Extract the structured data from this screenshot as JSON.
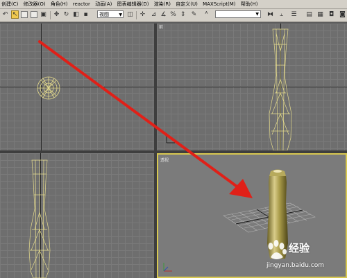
{
  "menu": {
    "items": [
      "创建(C)",
      "修改器(O)",
      "角色(H)",
      "reactor",
      "动画(A)",
      "图表编辑器(D)",
      "渲染(R)",
      "自定义(U)",
      "MAXScript(M)",
      "帮助(H)"
    ]
  },
  "toolbar": {
    "reference_coord": "视图",
    "named_selection": "",
    "icons": [
      "undo-icon",
      "redo-icon",
      "link-icon",
      "unlink-icon",
      "bind-space-warp-icon",
      "select-filter-icon",
      "select-object-icon",
      "select-by-name-icon",
      "rectangular-region-icon",
      "window-crossing-icon",
      "select-move-icon",
      "select-rotate-icon",
      "select-scale-icon",
      "snap-icon",
      "angle-snap-icon",
      "percent-snap-icon",
      "spinner-snap-icon",
      "mirror-icon",
      "align-icon",
      "layer-manager-icon",
      "curve-editor-icon",
      "material-editor-icon",
      "render-setup-icon",
      "quick-render-icon"
    ]
  },
  "viewports": {
    "top": {
      "label": ""
    },
    "front": {
      "label": "前"
    },
    "left": {
      "label": ""
    },
    "perspective": {
      "label": "透视"
    }
  },
  "colors": {
    "ui_bg": "#d4d0c8",
    "viewport_bg": "#6e6e6e",
    "wireframe": "#e6dc8c",
    "active_border": "#d8c850",
    "arrow": "#e02018"
  },
  "watermark": {
    "text": "经验",
    "url": "jingyan.baidu.com"
  }
}
